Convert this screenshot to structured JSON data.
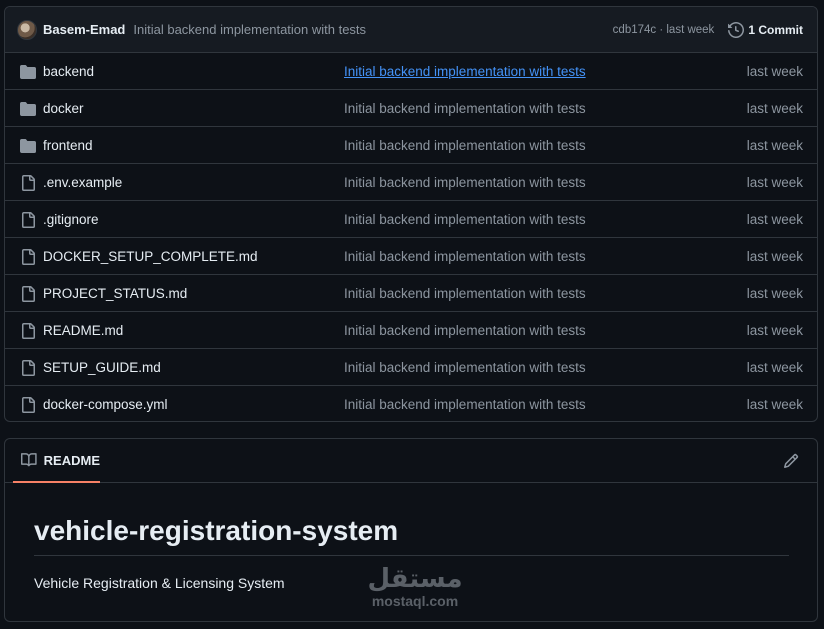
{
  "commit_header": {
    "author": "Basem-Emad",
    "message": "Initial backend implementation with tests",
    "sha_time": "cdb174c · last week",
    "commits_label": "1 Commit"
  },
  "files": [
    {
      "type": "folder",
      "name": "backend",
      "commit": "Initial backend implementation with tests",
      "date": "last week",
      "hovered": true
    },
    {
      "type": "folder",
      "name": "docker",
      "commit": "Initial backend implementation with tests",
      "date": "last week"
    },
    {
      "type": "folder",
      "name": "frontend",
      "commit": "Initial backend implementation with tests",
      "date": "last week"
    },
    {
      "type": "file",
      "name": ".env.example",
      "commit": "Initial backend implementation with tests",
      "date": "last week"
    },
    {
      "type": "file",
      "name": ".gitignore",
      "commit": "Initial backend implementation with tests",
      "date": "last week"
    },
    {
      "type": "file",
      "name": "DOCKER_SETUP_COMPLETE.md",
      "commit": "Initial backend implementation with tests",
      "date": "last week"
    },
    {
      "type": "file",
      "name": "PROJECT_STATUS.md",
      "commit": "Initial backend implementation with tests",
      "date": "last week"
    },
    {
      "type": "file",
      "name": "README.md",
      "commit": "Initial backend implementation with tests",
      "date": "last week"
    },
    {
      "type": "file",
      "name": "SETUP_GUIDE.md",
      "commit": "Initial backend implementation with tests",
      "date": "last week"
    },
    {
      "type": "file",
      "name": "docker-compose.yml",
      "commit": "Initial backend implementation with tests",
      "date": "last week"
    }
  ],
  "readme": {
    "tab_label": "README",
    "title": "vehicle-registration-system",
    "description": "Vehicle Registration & Licensing System"
  },
  "watermark": {
    "arabic": "مستقل",
    "latin": "mostaql.com"
  },
  "colors": {
    "background": "#0d1117",
    "link": "#4493f8",
    "tab_underline": "#f78166",
    "icon_gray": "#8d96a0"
  }
}
